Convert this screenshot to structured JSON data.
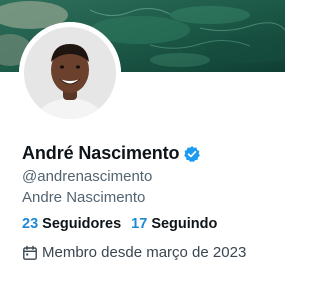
{
  "profile": {
    "display_name": "André Nascimento",
    "handle": "@andrenascimento",
    "secondary_name": "Andre Nascimento",
    "verified": true,
    "accent_color": "#1d9bf0"
  },
  "stats": {
    "followers_count": "23",
    "followers_label": "Seguidores",
    "following_count": "17",
    "following_label": "Seguindo"
  },
  "joined": {
    "icon": "calendar-icon",
    "text": "Membro desde março de 2023"
  },
  "cover": {
    "description_colors": [
      "#1f5a47",
      "#2f7a5f",
      "#a7b9a6"
    ]
  }
}
